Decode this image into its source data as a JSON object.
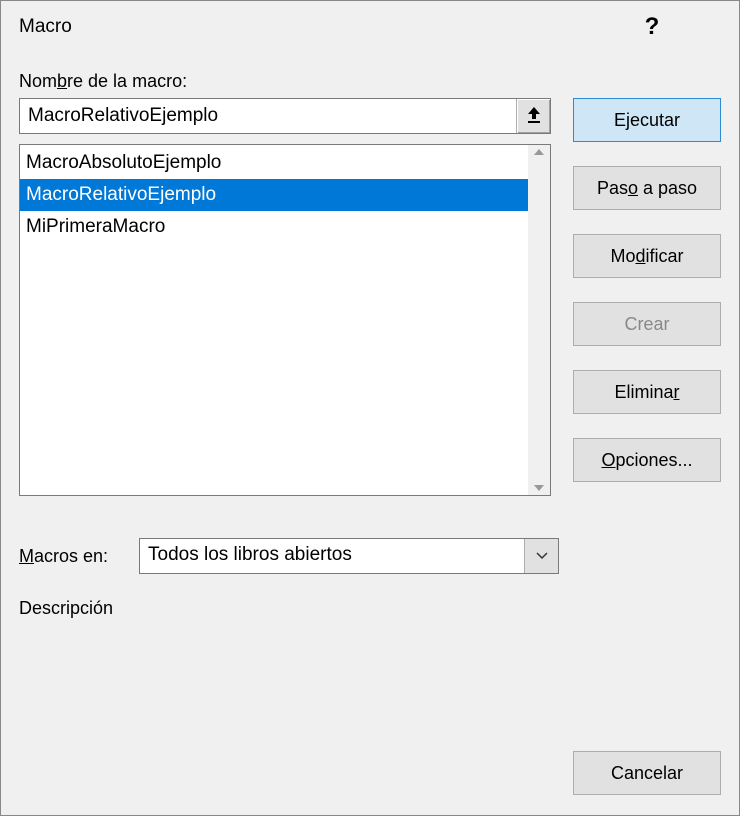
{
  "titlebar": {
    "title": "Macro"
  },
  "labels": {
    "macro_name": "Nombre de la macro:",
    "macros_in": "Macros en:",
    "description": "Descripción"
  },
  "name_input": {
    "value": "MacroRelativoEjemplo"
  },
  "macro_list": [
    {
      "name": "MacroAbsolutoEjemplo",
      "selected": false
    },
    {
      "name": "MacroRelativoEjemplo",
      "selected": true
    },
    {
      "name": "MiPrimeraMacro",
      "selected": false
    }
  ],
  "location_select": {
    "value": "Todos los libros abiertos"
  },
  "buttons": {
    "run_pre": "E",
    "run_u": "j",
    "run_post": "ecutar",
    "step_pre": "Pas",
    "step_u": "o",
    "step_post": " a paso",
    "edit_pre": "Mo",
    "edit_u": "d",
    "edit_post": "ificar",
    "create": "Crear",
    "delete_pre": "Elimina",
    "delete_u": "r",
    "delete_post": "",
    "options_pre": "",
    "options_u": "O",
    "options_post": "pciones...",
    "cancel": "Cancelar"
  },
  "label_parts": {
    "name_pre": "Nom",
    "name_u": "b",
    "name_post": "re de la macro:",
    "loc_u": "M",
    "loc_post": "acros en:"
  }
}
